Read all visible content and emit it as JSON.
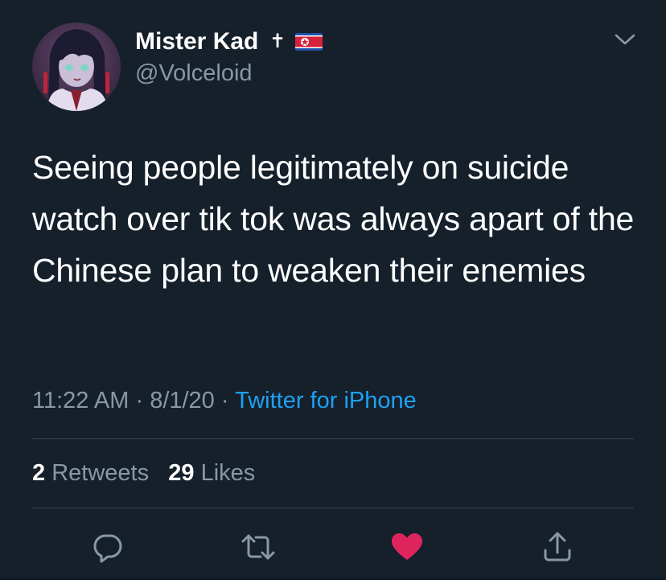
{
  "tweet": {
    "display_name": "Mister Kad",
    "handle": "@Volceloid",
    "name_badges": [
      "cross-icon",
      "north-korea-flag-icon"
    ],
    "text": "Seeing people legitimately on suicide watch over tik tok was always apart of the Chinese plan to weaken their enemies",
    "time": "11:22 AM",
    "separator": "·",
    "date": "8/1/20",
    "source": "Twitter for iPhone",
    "retweets_count": "2",
    "retweets_label": "Retweets",
    "likes_count": "29",
    "likes_label": "Likes",
    "liked": true
  },
  "colors": {
    "background": "#15202b",
    "secondary_text": "#8899a6",
    "link": "#1da1f2",
    "like": "#e0245e",
    "divider": "#38444d"
  },
  "icons": {
    "more": "chevron-down-icon",
    "reply": "reply-icon",
    "retweet": "retweet-icon",
    "like": "heart-icon",
    "share": "share-icon"
  }
}
